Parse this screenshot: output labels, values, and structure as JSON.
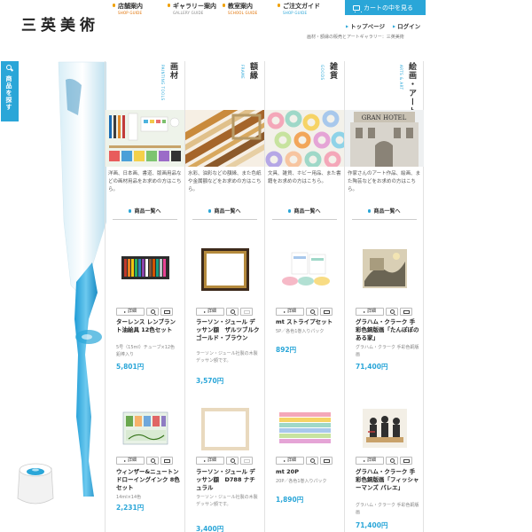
{
  "brand": {
    "logo": "三英美術"
  },
  "nav": [
    {
      "label": "店舗案内",
      "sub": "SHOP GUIDE"
    },
    {
      "label": "ギャラリー案内",
      "sub": "GALLERY GUIDE"
    },
    {
      "label": "教室案内",
      "sub": "SCHOOL GUIDE"
    },
    {
      "label": "ご注文ガイド",
      "sub": "SHOP GUIDE"
    }
  ],
  "header": {
    "cart_label": "カートの中を見る",
    "top_link": "トップページ",
    "login_link": "ログイン",
    "tagline": "画材・額縁の販売とアートギャラリー：三英美術"
  },
  "search_tab": {
    "label": "商品を探す"
  },
  "more_label": "商品一覧へ",
  "buttons": {
    "detail": "詳細"
  },
  "categories": [
    {
      "title": "画材",
      "subtitle": "PAINTING TOOLS",
      "description": "洋画、日本画、書道、版画用品などの画材用品をお求めの方はこちら。",
      "products": [
        {
          "name": "ターレンス レンブラント油絵具 12色セット",
          "note": "5号（15ml）チューブ×12色　鉛棒入り",
          "price": "5,801円"
        },
        {
          "name": "ウィンザー&ニュートン ドローイングインク 8色セット",
          "note": "14ml×14色",
          "price": "2,231円"
        }
      ]
    },
    {
      "title": "額縁",
      "subtitle": "FRAME",
      "description": "水彩、油彩などの額縁、また色紙や金属額などをお求めの方はこちら。",
      "products": [
        {
          "name": "ラーソン・ジュール デッサン額　ザルツブルク ゴールド・ブラウン",
          "note": "ラーソン・ジュール社製の木製デッサン額です。",
          "price": "3,570円"
        },
        {
          "name": "ラーソン・ジュール デッサン額　D788 ナチュラル",
          "note": "ラーソン・ジュール社製の木製デッサン額です。",
          "price": "3,400円"
        }
      ]
    },
    {
      "title": "雑貨",
      "subtitle": "GOODS",
      "description": "文具、雑貨、ホビー用品、また書籍をお求めの方はこちら。",
      "products": [
        {
          "name": "mt ストライプセット",
          "note": "5P／各色1巻入りパック",
          "price": "892円"
        },
        {
          "name": "mt 20P",
          "note": "20P／各色1巻入りパック",
          "price": "1,890円"
        }
      ]
    },
    {
      "title": "絵画・アート",
      "subtitle": "ARTS & ART",
      "description": "作家さんのアート作品、絵画、また陶芸などをお求めの方はこちら。",
      "products": [
        {
          "name": "グラハム・クラーク 手彩色銅版画「たんぽぽのある家」",
          "note": "グラハム・クラーク 手彩色銅版画",
          "price": "71,400円"
        },
        {
          "name": "グラハム・クラーク 手彩色銅版画「フィッシャーマンズ パレエ」",
          "note": "グラハム・クラーク 手彩色銅版画",
          "price": "71,400円"
        }
      ]
    }
  ],
  "colors": {
    "accent": "#2aa6d8",
    "nav_sub": "#e07000"
  }
}
